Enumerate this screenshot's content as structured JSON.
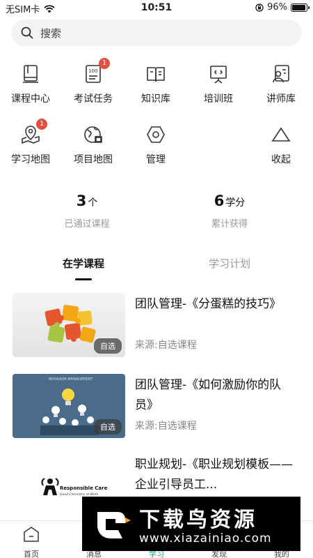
{
  "status_bar": {
    "carrier": "无SIM卡",
    "time": "10:51",
    "battery": "96%",
    "battery_level": 0.96
  },
  "search": {
    "placeholder": "搜索"
  },
  "grid": [
    {
      "label": "课程中心",
      "icon": "book-icon"
    },
    {
      "label": "考试任务",
      "icon": "exam-paper-icon",
      "badge": "1"
    },
    {
      "label": "知识库",
      "icon": "open-book-icon"
    },
    {
      "label": "培训班",
      "icon": "presentation-board-icon"
    },
    {
      "label": "讲师库",
      "icon": "instructor-icon"
    },
    {
      "label": "学习地图",
      "icon": "map-pin-icon",
      "badge": "1"
    },
    {
      "label": "项目地图",
      "icon": "globe-icon"
    },
    {
      "label": "管理",
      "icon": "hexagon-settings-icon"
    },
    {
      "label": "收起",
      "icon": "triangle-collapse-icon"
    }
  ],
  "stats": [
    {
      "value": "3",
      "unit": "个",
      "desc": "已通过课程"
    },
    {
      "value": "6",
      "unit": "学分",
      "desc": "累计获得"
    }
  ],
  "tabs": [
    {
      "label": "在学课程",
      "active": true
    },
    {
      "label": "学习计划",
      "active": false
    }
  ],
  "courses": [
    {
      "title": "团队管理-《分蛋糕的技巧》",
      "source": "来源:自选课程",
      "tag": "自选"
    },
    {
      "title": "团队管理-《如何激励你的队员》",
      "source": "来源:自选课程",
      "tag": "自选",
      "thumb_caption": "BEHAVIOR MANAGEMENT"
    },
    {
      "title": "职业规划-《职业规划模板——企业引导员工...",
      "logo_text": "Responsible Care",
      "logo_subtext": "Good Chemistry at Work"
    }
  ],
  "tabbar": [
    {
      "label": "首页",
      "icon": "home-icon"
    },
    {
      "label": "消息",
      "icon": "message-icon"
    },
    {
      "label": "学习",
      "icon": "study-icon"
    },
    {
      "label": "发现",
      "icon": "discover-icon"
    },
    {
      "label": "我的",
      "icon": "profile-icon"
    }
  ],
  "watermark": {
    "title": "下载鸟资源",
    "url": "www.xiazainiao.com"
  }
}
